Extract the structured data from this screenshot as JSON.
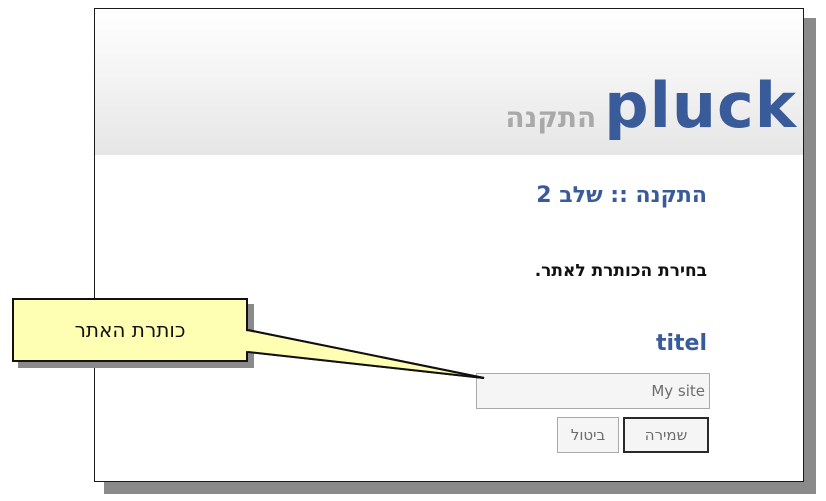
{
  "header": {
    "logo": "pluck",
    "subtitle": "התקנה"
  },
  "main": {
    "page_title": "התקנה :: שלב 2",
    "instruction": "בחירת הכותרת לאתר.",
    "field_label": "titel",
    "title_input": {
      "value": "My site"
    },
    "buttons": {
      "save_label": "שמירה",
      "cancel_label": "ביטול"
    }
  },
  "annotation": {
    "callout_text": "כותרת האתר"
  },
  "colors": {
    "accent": "#3a5b9a",
    "callout_fill": "#ffffb3",
    "muted_text": "#a9a9a9"
  }
}
